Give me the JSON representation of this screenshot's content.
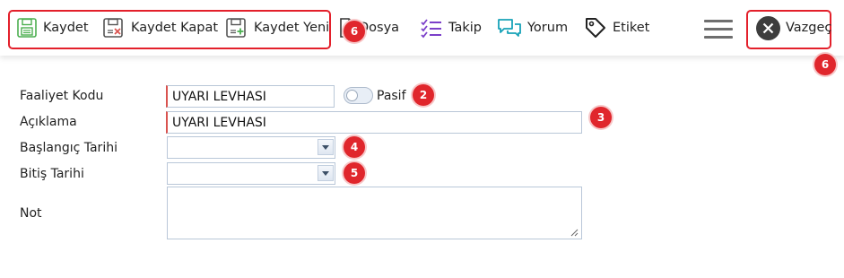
{
  "toolbar": {
    "save_label": "Kaydet",
    "save_close_label": "Kaydet Kapat",
    "save_new_label": "Kaydet Yeni",
    "file_label": "Dosya",
    "follow_label": "Takip",
    "comment_label": "Yorum",
    "tag_label": "Etiket",
    "cancel_label": "Vazgeç"
  },
  "badges": {
    "toolbar_left": "6",
    "toolbar_right": "6",
    "status": "2",
    "description": "3",
    "start_date": "4",
    "end_date": "5"
  },
  "form": {
    "activity_code_label": "Faaliyet Kodu",
    "activity_code_value": "UYARI LEVHASI",
    "status_label": "Pasif",
    "description_label": "Açıklama",
    "description_value": "UYARI LEVHASI",
    "start_date_label": "Başlangıç Tarihi",
    "start_date_value": "",
    "end_date_label": "Bitiş Tarihi",
    "end_date_value": "",
    "note_label": "Not",
    "note_value": ""
  },
  "colors": {
    "highlight": "#e3202b",
    "badge": "#e0262c",
    "save_icon": "#4caf50",
    "follow_icon": "#7b3fc9",
    "comment_icon": "#17a2b8"
  }
}
